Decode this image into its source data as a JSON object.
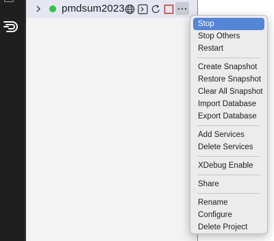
{
  "project": {
    "name": "pmdsum2023",
    "status": "running",
    "status_color": "#2fc445"
  },
  "row_icons": [
    "globe-icon",
    "terminal-icon",
    "restart-icon",
    "stop-icon",
    "more-icon"
  ],
  "menu": {
    "groups": [
      [
        {
          "label": "Stop",
          "highlighted": true
        },
        {
          "label": "Stop Others"
        },
        {
          "label": "Restart"
        }
      ],
      [
        {
          "label": "Create Snapshot"
        },
        {
          "label": "Restore Snapshot"
        },
        {
          "label": "Clear All Snapshot"
        },
        {
          "label": "Import Database"
        },
        {
          "label": "Export Database"
        }
      ],
      [
        {
          "label": "Add Services"
        },
        {
          "label": "Delete Services"
        }
      ],
      [
        {
          "label": "XDebug Enable"
        }
      ],
      [
        {
          "label": "Share"
        }
      ],
      [
        {
          "label": "Rename"
        },
        {
          "label": "Configure"
        },
        {
          "label": "Delete Project"
        }
      ]
    ]
  },
  "colors": {
    "activity_bar": "#1f1f1f",
    "sidebar": "#f3f3f3",
    "menu_highlight": "#5585d6",
    "stop_icon": "#c0392b"
  }
}
